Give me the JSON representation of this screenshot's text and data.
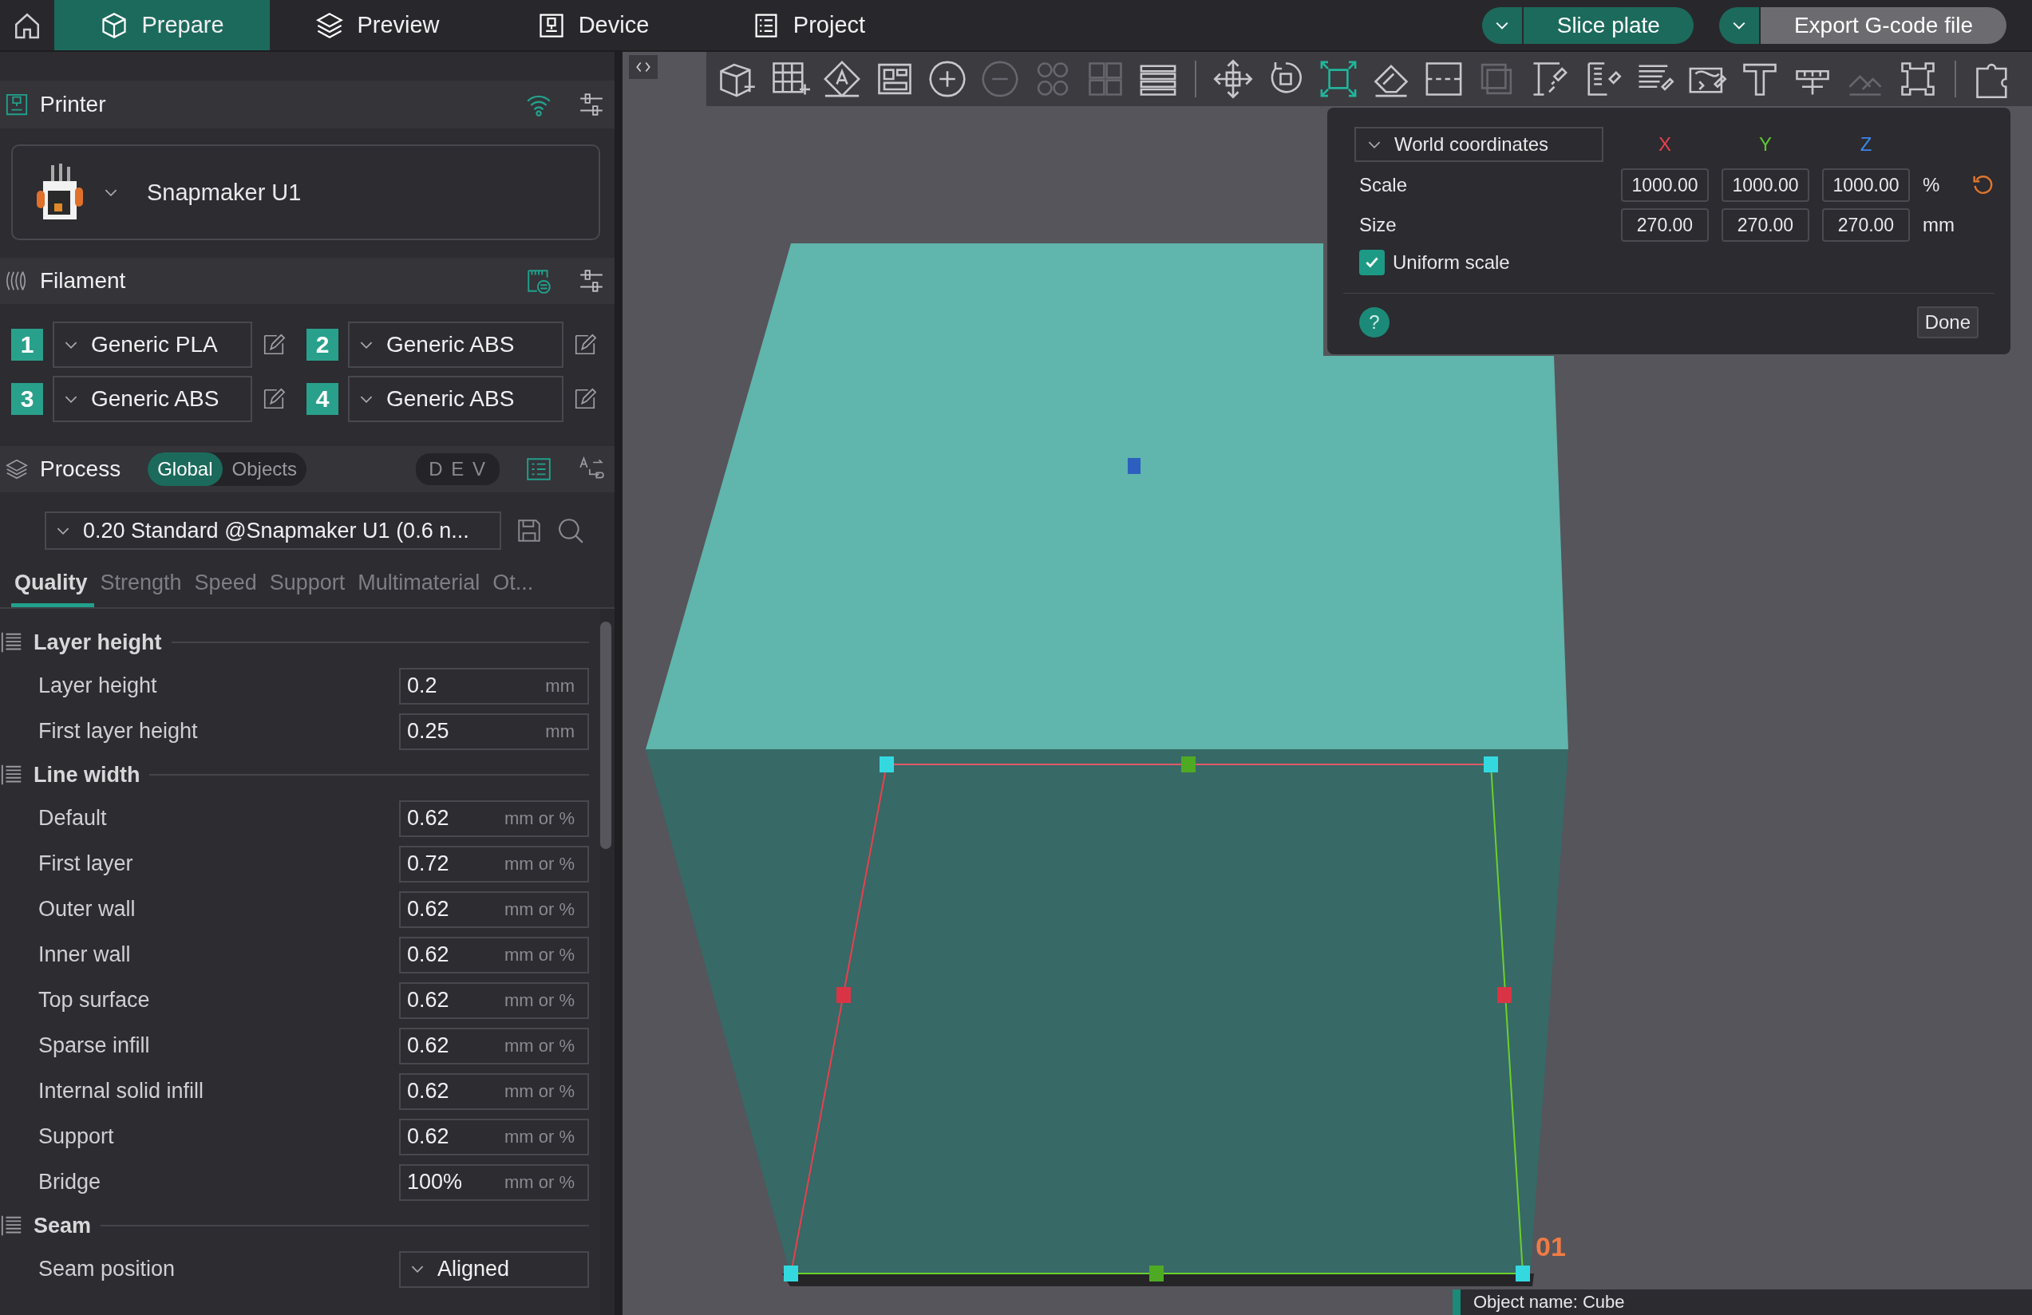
{
  "nav_tabs": [
    {
      "label": "Prepare",
      "selected": true,
      "kind": "prepare"
    },
    {
      "label": "Preview",
      "selected": false,
      "kind": "preview"
    },
    {
      "label": "Device",
      "selected": false,
      "kind": "device"
    },
    {
      "label": "Project",
      "selected": false,
      "kind": "project"
    }
  ],
  "actions": [
    {
      "label": "Slice plate",
      "kind": "primary"
    },
    {
      "label": "Export G-code file",
      "kind": "secondary"
    }
  ],
  "toolbar": [
    {
      "selected": false,
      "disabled": false
    },
    {
      "selected": false,
      "disabled": false
    },
    {
      "selected": false,
      "disabled": false
    },
    {
      "selected": false,
      "disabled": false
    },
    {
      "selected": false,
      "disabled": false
    },
    {
      "selected": false,
      "disabled": true
    },
    {
      "selected": false,
      "disabled": true
    },
    {
      "selected": false,
      "disabled": true
    },
    {
      "selected": false,
      "disabled": false
    },
    {
      "selected": false,
      "disabled": false
    },
    {
      "selected": false,
      "disabled": false
    },
    {
      "selected": true,
      "disabled": false
    },
    {
      "selected": false,
      "disabled": false
    },
    {
      "selected": false,
      "disabled": false
    },
    {
      "selected": false,
      "disabled": true
    },
    {
      "selected": false,
      "disabled": false
    },
    {
      "selected": false,
      "disabled": false
    },
    {
      "selected": false,
      "disabled": false
    },
    {
      "selected": false,
      "disabled": false
    },
    {
      "selected": false,
      "disabled": false
    },
    {
      "selected": false,
      "disabled": false
    },
    {
      "selected": false,
      "disabled": true
    },
    {
      "selected": false,
      "disabled": false
    },
    {
      "selected": false,
      "disabled": false
    }
  ],
  "printer": {
    "title": "Printer",
    "name": "Snapmaker U1"
  },
  "filament": {
    "title": "Filament",
    "slots": [
      {
        "number": "1",
        "name": "Generic PLA"
      },
      {
        "number": "2",
        "name": "Generic ABS"
      },
      {
        "number": "3",
        "name": "Generic ABS"
      },
      {
        "number": "4",
        "name": "Generic ABS"
      }
    ]
  },
  "process": {
    "title": "Process",
    "scope": [
      {
        "label": "Global",
        "selected": true
      },
      {
        "label": "Objects",
        "selected": false
      }
    ],
    "badge": "D E V",
    "preset": "0.20 Standard @Snapmaker U1 (0.6 n...",
    "tabs": [
      {
        "label": "Quality",
        "selected": true
      },
      {
        "label": "Strength",
        "selected": false
      },
      {
        "label": "Speed",
        "selected": false
      },
      {
        "label": "Support",
        "selected": false
      },
      {
        "label": "Multimaterial",
        "selected": false
      },
      {
        "label": "Ot...",
        "selected": false
      }
    ]
  },
  "groups": [
    {
      "title": "Layer height",
      "rows": [
        {
          "kind": "number",
          "label": "Layer height",
          "value": "0.2",
          "unit": "mm"
        },
        {
          "kind": "number",
          "label": "First layer height",
          "value": "0.25",
          "unit": "mm"
        }
      ]
    },
    {
      "title": "Line width",
      "rows": [
        {
          "kind": "number",
          "label": "Default",
          "value": "0.62",
          "unit": "mm or %"
        },
        {
          "kind": "number",
          "label": "First layer",
          "value": "0.72",
          "unit": "mm or %"
        },
        {
          "kind": "number",
          "label": "Outer wall",
          "value": "0.62",
          "unit": "mm or %"
        },
        {
          "kind": "number",
          "label": "Inner wall",
          "value": "0.62",
          "unit": "mm or %"
        },
        {
          "kind": "number",
          "label": "Top surface",
          "value": "0.62",
          "unit": "mm or %"
        },
        {
          "kind": "number",
          "label": "Sparse infill",
          "value": "0.62",
          "unit": "mm or %"
        },
        {
          "kind": "number",
          "label": "Internal solid infill",
          "value": "0.62",
          "unit": "mm or %"
        },
        {
          "kind": "number",
          "label": "Support",
          "value": "0.62",
          "unit": "mm or %"
        },
        {
          "kind": "number",
          "label": "Bridge",
          "value": "100%",
          "unit": "mm or %"
        }
      ]
    },
    {
      "title": "Seam",
      "rows": [
        {
          "kind": "dropdown",
          "label": "Seam position",
          "value": "Aligned"
        }
      ]
    }
  ],
  "scale_panel": {
    "coordinates": "World coordinates",
    "axes": [
      {
        "label": "X",
        "color": "#e8404f"
      },
      {
        "label": "Y",
        "color": "#5cc72e"
      },
      {
        "label": "Z",
        "color": "#3d86e8"
      }
    ],
    "rows": [
      {
        "label": "Scale",
        "values": [
          "1000.00",
          "1000.00",
          "1000.00"
        ],
        "unit": "%",
        "reset": true
      },
      {
        "label": "Size",
        "values": [
          "270.00",
          "270.00",
          "270.00"
        ],
        "unit": "mm",
        "reset": false
      }
    ],
    "uniform_scale": {
      "label": "Uniform scale",
      "checked": true
    },
    "help": "?",
    "done": "Done"
  },
  "viewport": {
    "object_label": "01",
    "object_name": "Object name: Cube"
  }
}
